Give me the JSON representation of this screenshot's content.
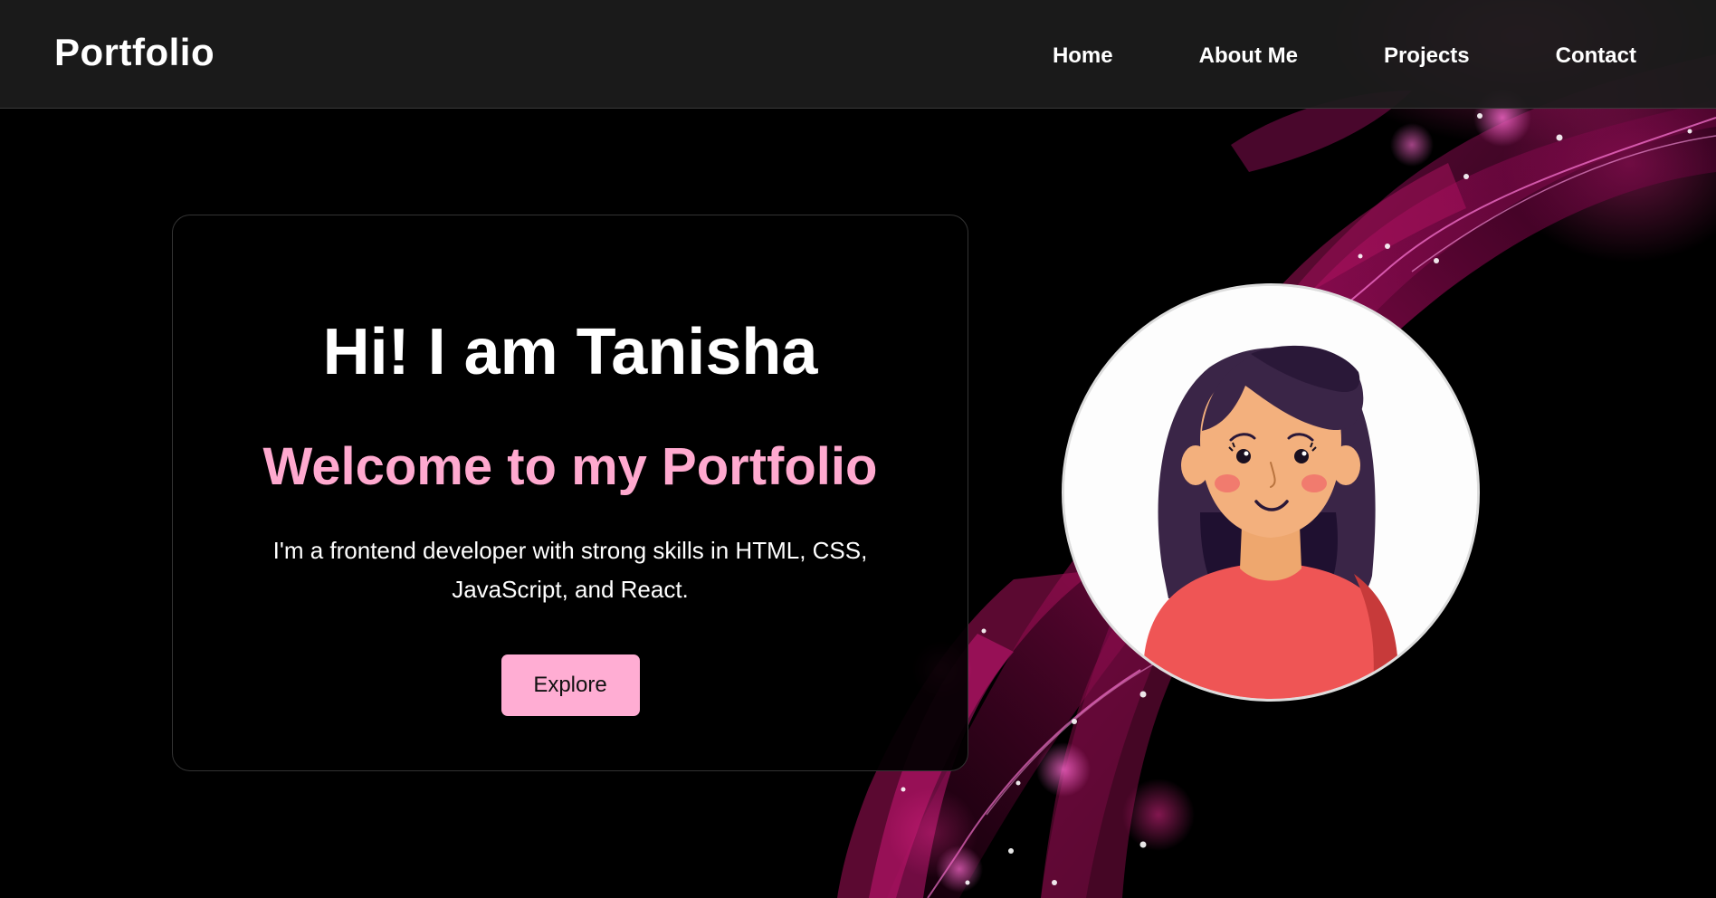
{
  "nav": {
    "brand": "Portfolio",
    "links": [
      "Home",
      "About Me",
      "Projects",
      "Contact"
    ]
  },
  "hero": {
    "greeting": "Hi! I am Tanisha",
    "welcome": "Welcome to my Portfolio",
    "intro": "I'm a frontend developer with strong skills in HTML, CSS, JavaScript, and React.",
    "button_label": "Explore"
  },
  "avatar": {
    "icon": "girl-avatar-illustration"
  },
  "colors": {
    "background": "#000000",
    "navbar": "#1c1c1c",
    "accent_pink": "#ffa9cf",
    "button_pink": "#ffadd3",
    "glow_magenta": "#e0107a"
  }
}
